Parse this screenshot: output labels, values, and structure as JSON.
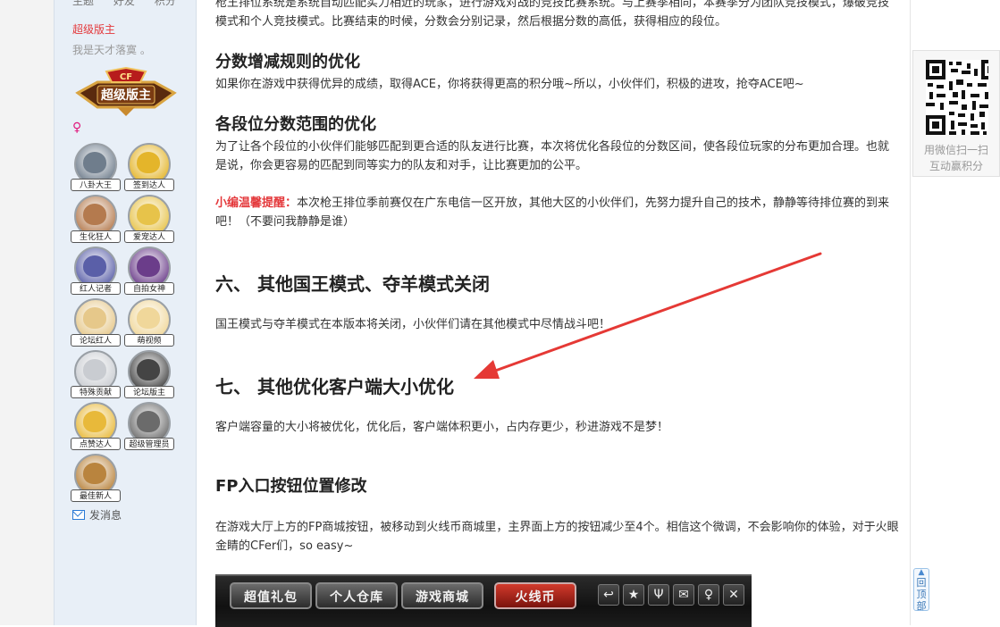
{
  "sidebar": {
    "stats": [
      "主题",
      "好友",
      "积分"
    ],
    "rank_title": "超级版主",
    "signature": "我是天才落寞 。",
    "rank_badge_text": "超级版主",
    "gender_symbol": "♀",
    "medals": [
      {
        "label": "八卦大王",
        "color": "#6f7d8c"
      },
      {
        "label": "签到达人",
        "color": "#e4b52a"
      },
      {
        "label": "生化狂人",
        "color": "#b47a4e"
      },
      {
        "label": "爱宠达人",
        "color": "#e7c34a"
      },
      {
        "label": "红人记者",
        "color": "#5a5fa8"
      },
      {
        "label": "自拍女神",
        "color": "#6b3d8a"
      },
      {
        "label": "论坛红人",
        "color": "#e6c88a"
      },
      {
        "label": "萌视频",
        "color": "#f0d79a"
      },
      {
        "label": "特殊贡献",
        "color": "#c9ccd1"
      },
      {
        "label": "论坛版主",
        "color": "#444444"
      },
      {
        "label": "点赞达人",
        "color": "#e8b93a"
      },
      {
        "label": "超级管理员",
        "color": "#6b6b6b"
      },
      {
        "label": "最佳新人",
        "color": "#b9843e"
      }
    ],
    "send_message": "发消息"
  },
  "article": {
    "intro": "枪王排位系统是系统自动匹配实力相近的玩家，进行游戏对战的竞技比赛系统。与上赛季相同，本赛季分为团队竞技模式，爆破竞技模式和个人竞技模式。比赛结束的时候，分数会分别记录，然后根据分数的高低，获得相应的段位。",
    "h_score": "分数增减规则的优化",
    "p_score": "如果你在游戏中获得优异的成绩，取得ACE，你将获得更高的积分哦~所以，小伙伴们，积极的进攻，抢夺ACE吧~",
    "h_range": "各段位分数范围的优化",
    "p_range": "为了让各个段位的小伙伴们能够匹配到更合适的队友进行比赛，本次将优化各段位的分数区间，使各段位玩家的分布更加合理。也就是说，你会更容易的匹配到同等实力的队友和对手，让比赛更加的公平。",
    "tip_label": "小编温馨提醒：",
    "tip_text": "本次枪王排位季前赛仅在广东电信一区开放，其他大区的小伙伴们，先努力提升自己的技术，静静等待排位赛的到来吧！（不要问我静静是谁）",
    "h_six": "六、 其他国王模式、夺羊模式关闭",
    "p_six": "国王模式与夺羊模式在本版本将关闭，小伙伴们请在其他模式中尽情战斗吧！",
    "h_seven": "七、 其他优化客户端大小优化",
    "p_seven": "客户端容量的大小将被优化，优化后，客户端体积更小，占内存更少，秒进游戏不是梦！",
    "h_fp": "FP入口按钮位置修改",
    "p_fp": "在游戏大厅上方的FP商城按钮，被移动到火线币商城里，主界面上方的按钮减少至4个。相信这个微调，不会影响你的体验，对于火眼金睛的CFer们，so easy~"
  },
  "game_toolbar": {
    "buttons": [
      "超值礼包",
      "个人仓库",
      "游戏商城",
      "火线币"
    ],
    "icons": [
      "back-icon",
      "shield-icon",
      "trophy-icon",
      "mail-icon",
      "bulb-icon",
      "close-icon"
    ]
  },
  "right_panel": {
    "qr_caption_1": "用微信扫一扫",
    "qr_caption_2": "互动赢积分",
    "back_top": "回顶部"
  },
  "colors": {
    "accent_red": "#e4393c",
    "annotation_arrow": "#e53935",
    "sidebar_bg": "#e8eff7"
  }
}
